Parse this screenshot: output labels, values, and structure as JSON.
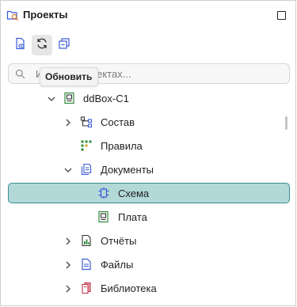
{
  "panel": {
    "title": "Проекты",
    "title_icon": "projects-folder-icon",
    "restore_icon": "restore-window-icon"
  },
  "toolbar": {
    "buttons": [
      {
        "icon": "open-project-icon"
      },
      {
        "icon": "refresh-icon"
      },
      {
        "icon": "collapse-all-icon"
      }
    ],
    "tooltip": "Обновить"
  },
  "search": {
    "placeholder": "Искать в проектах...",
    "icon": "search-icon"
  },
  "tree": {
    "items": [
      {
        "label": "ddBox-C1",
        "icon": "board-chip-icon",
        "expanded": true,
        "level": 0
      },
      {
        "label": "Состав",
        "icon": "hierarchy-icon",
        "expanded": false,
        "level": 1
      },
      {
        "label": "Правила",
        "icon": "rules-grid-icon",
        "level": 1
      },
      {
        "label": "Документы",
        "icon": "documents-icon",
        "expanded": true,
        "level": 1
      },
      {
        "label": "Схема",
        "icon": "schematic-icon",
        "level": 2,
        "selected": true
      },
      {
        "label": "Плата",
        "icon": "board-chip-icon",
        "level": 2
      },
      {
        "label": "Отчёты",
        "icon": "report-chart-icon",
        "expanded": false,
        "level": 1
      },
      {
        "label": "Файлы",
        "icon": "file-icon",
        "expanded": false,
        "level": 1
      },
      {
        "label": "Библиотека",
        "icon": "library-books-icon",
        "expanded": false,
        "level": 1
      }
    ]
  },
  "colors": {
    "selection_bg": "#b2d8d8",
    "selection_border": "#3a8f8f",
    "icon_blue": "#3b5bd6",
    "icon_green": "#2e8b3a"
  }
}
